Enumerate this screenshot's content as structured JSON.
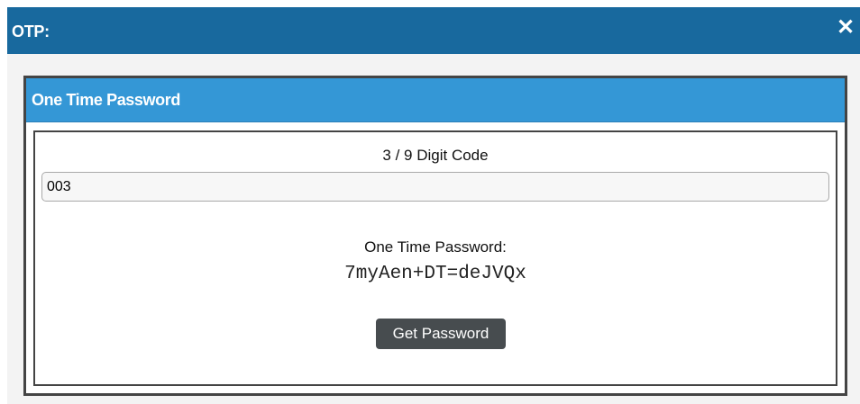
{
  "dialog": {
    "title": "OTP:",
    "close_icon": "✕",
    "close_icon_name": "close-icon"
  },
  "panel": {
    "header": "One Time Password",
    "code_label": "3 / 9 Digit Code",
    "code_value": "003",
    "otp_label": "One Time Password:",
    "otp_value": "7myAen+DT=deJVQx",
    "button_label": "Get Password"
  },
  "colors": {
    "titlebar": "#18699e",
    "panel_header": "#3497d6",
    "button": "#474c4f"
  }
}
